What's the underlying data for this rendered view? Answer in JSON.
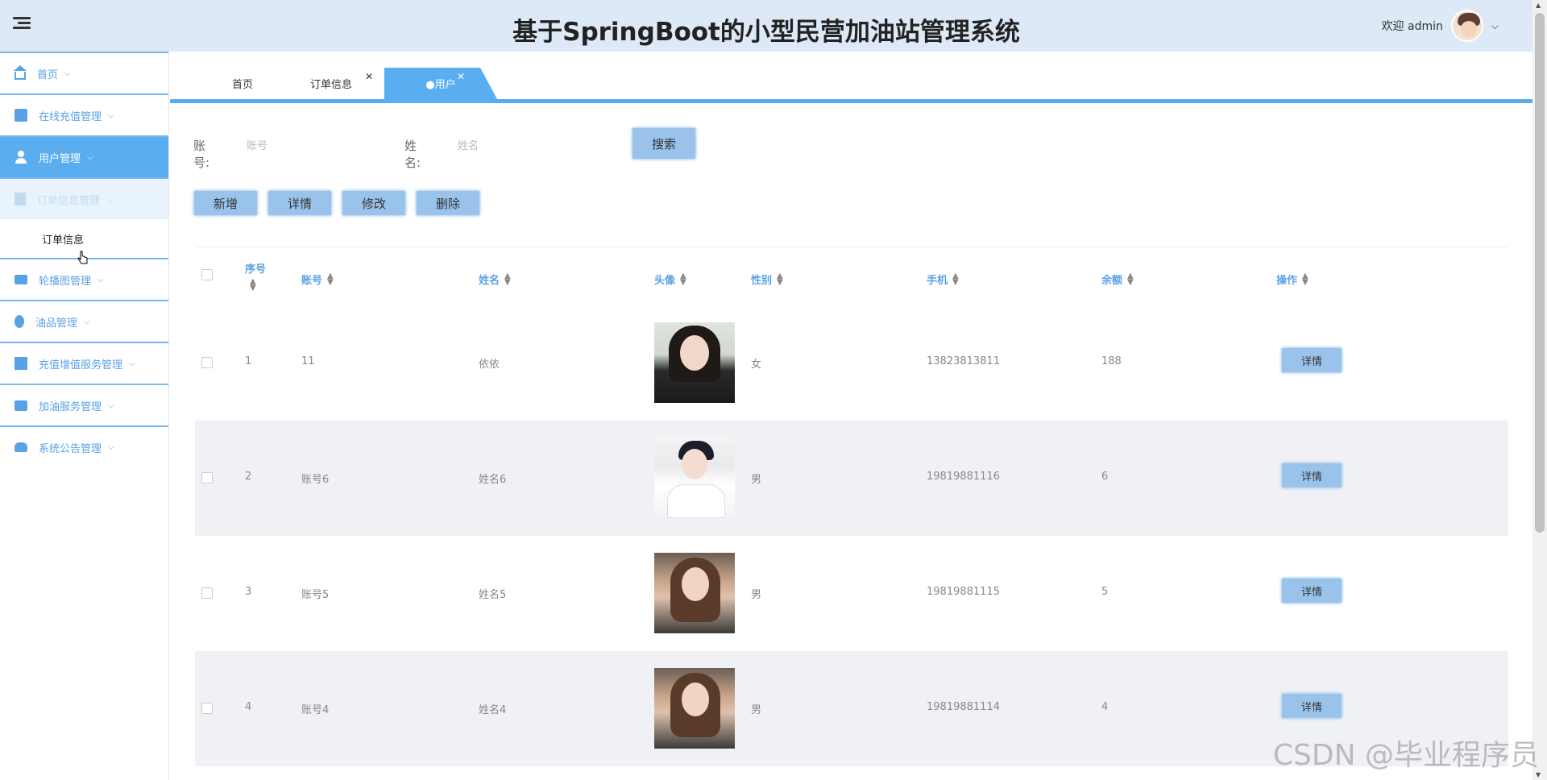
{
  "app": {
    "title": "基于SpringBoot的小型民营加油站管理系统"
  },
  "user": {
    "welcome": "欢迎 admin"
  },
  "sidebar": {
    "items": [
      {
        "label": "首页",
        "icon": "home-icon"
      },
      {
        "label": "在线充值管理",
        "icon": "briefcase-icon"
      },
      {
        "label": "用户管理",
        "icon": "user-icon"
      },
      {
        "label": "订单信息管理",
        "icon": "document-icon"
      },
      {
        "label": "轮播图管理",
        "icon": "card-icon"
      },
      {
        "label": "油品管理",
        "icon": "drop-icon"
      },
      {
        "label": "充值增值服务管理",
        "icon": "book-icon"
      },
      {
        "label": "加油服务管理",
        "icon": "case-icon"
      },
      {
        "label": "系统公告管理",
        "icon": "car-icon"
      }
    ],
    "sub_item": "订单信息"
  },
  "tabs": [
    {
      "label": "首页"
    },
    {
      "label": "订单信息"
    },
    {
      "label": "●用户"
    }
  ],
  "search": {
    "account_label": "账号:",
    "account_placeholder": "账号",
    "name_label": "姓名:",
    "name_placeholder": "姓名",
    "button": "搜索"
  },
  "actions": {
    "add": "新增",
    "detail": "详情",
    "edit": "修改",
    "delete": "删除"
  },
  "table": {
    "columns": [
      "序号",
      "账号",
      "姓名",
      "头像",
      "性别",
      "手机",
      "余额",
      "操作"
    ],
    "rows": [
      {
        "index": "1",
        "account": "11",
        "name": "依依",
        "gender": "女",
        "phone": "13823813811",
        "balance": "188",
        "action": "详情"
      },
      {
        "index": "2",
        "account": "账号6",
        "name": "姓名6",
        "gender": "男",
        "phone": "19819881116",
        "balance": "6",
        "action": "详情"
      },
      {
        "index": "3",
        "account": "账号5",
        "name": "姓名5",
        "gender": "男",
        "phone": "19819881115",
        "balance": "5",
        "action": "详情"
      },
      {
        "index": "4",
        "account": "账号4",
        "name": "姓名4",
        "gender": "男",
        "phone": "19819881114",
        "balance": "4",
        "action": "详情"
      }
    ]
  },
  "watermark": "CSDN @毕业程序员",
  "colors": {
    "accent": "#5aaef0",
    "header_bg": "#dde9f7",
    "button_bg": "#9ac3ec"
  }
}
